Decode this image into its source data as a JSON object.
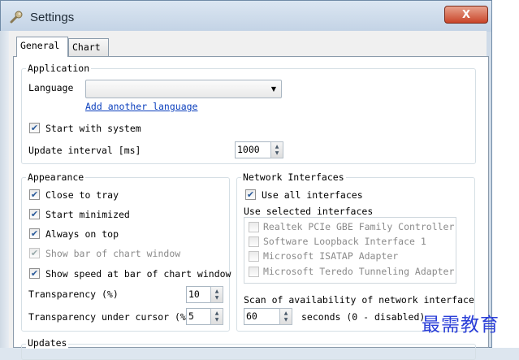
{
  "window": {
    "title": "Settings",
    "close_label": "X"
  },
  "tabs": [
    "General",
    "Chart"
  ],
  "application": {
    "group_label": "Application",
    "language_label": "Language",
    "language_value": "",
    "add_language_link": "Add another language",
    "start_with_system_label": "Start with system",
    "start_with_system_checked": true,
    "update_interval_label": "Update interval [ms]",
    "update_interval_value": "1000"
  },
  "appearance": {
    "group_label": "Appearance",
    "close_to_tray": {
      "label": "Close to tray",
      "checked": true
    },
    "start_minimized": {
      "label": "Start minimized",
      "checked": true
    },
    "always_on_top": {
      "label": "Always on top",
      "checked": true
    },
    "show_bar": {
      "label": "Show bar of chart window",
      "checked": true,
      "disabled": true
    },
    "show_speed": {
      "label": "Show speed at bar of chart window",
      "checked": true
    },
    "transparency_label": "Transparency (%)",
    "transparency_value": "10",
    "transparency_cursor_label": "Transparency under cursor (%",
    "transparency_cursor_value": "5"
  },
  "network": {
    "group_label": "Network Interfaces",
    "use_all_label": "Use all interfaces",
    "use_all_checked": true,
    "use_selected_label": "Use selected interfaces",
    "interfaces": [
      "Realtek PCIe GBE Family Controller",
      "Software Loopback Interface 1",
      "Microsoft ISATAP Adapter",
      "Microsoft Teredo Tunneling Adapter"
    ],
    "scan_label": "Scan of availability of network interface:",
    "scan_value": "60",
    "scan_unit": "seconds (0 - disabled)"
  },
  "updates": {
    "group_label": "Updates"
  },
  "watermark": "最需教育",
  "check_mark": "✔",
  "spin_up": "▲",
  "spin_down": "▼",
  "dropdown_arrow": "▼",
  "colors": {
    "link": "#0b3fbd",
    "check": "#2a5a9a",
    "close": "#c9452a",
    "watermark": "#2b3fd8"
  }
}
